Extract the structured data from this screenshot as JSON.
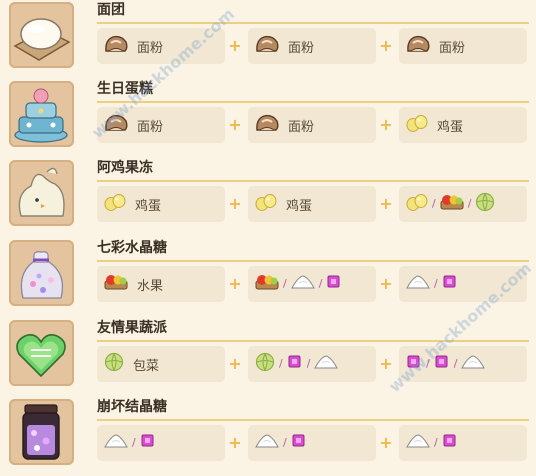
{
  "recipes": [
    {
      "title": "面团",
      "thumb": "dough-icon",
      "slots": [
        [
          {
            "icon": "flour-icon",
            "label": "面粉"
          }
        ],
        [
          {
            "icon": "flour-icon",
            "label": "面粉"
          }
        ],
        [
          {
            "icon": "flour-icon",
            "label": "面粉"
          }
        ]
      ]
    },
    {
      "title": "生日蛋糕",
      "thumb": "birthday-cake-icon",
      "slots": [
        [
          {
            "icon": "flour-icon",
            "label": "面粉"
          }
        ],
        [
          {
            "icon": "flour-icon",
            "label": "面粉"
          }
        ],
        [
          {
            "icon": "egg-icon",
            "label": "鸡蛋"
          }
        ]
      ]
    },
    {
      "title": "阿鸡果冻",
      "thumb": "chick-jelly-icon",
      "slots": [
        [
          {
            "icon": "egg-icon",
            "label": "鸡蛋"
          }
        ],
        [
          {
            "icon": "egg-icon",
            "label": "鸡蛋"
          }
        ],
        [
          {
            "icon": "egg-icon"
          },
          {
            "icon": "fruit-icon"
          },
          {
            "icon": "cabbage-icon"
          }
        ]
      ]
    },
    {
      "title": "七彩水晶糖",
      "thumb": "crystal-candy-bag-icon",
      "slots": [
        [
          {
            "icon": "fruit-icon",
            "label": "水果"
          }
        ],
        [
          {
            "icon": "fruit-icon"
          },
          {
            "icon": "salt-icon"
          },
          {
            "icon": "crystal-icon"
          }
        ],
        [
          {
            "icon": "salt-icon"
          },
          {
            "icon": "crystal-icon"
          }
        ]
      ]
    },
    {
      "title": "友情果蔬派",
      "thumb": "heart-pie-icon",
      "slots": [
        [
          {
            "icon": "cabbage-icon",
            "label": "包菜"
          }
        ],
        [
          {
            "icon": "cabbage-icon"
          },
          {
            "icon": "crystal-icon"
          },
          {
            "icon": "salt-icon"
          }
        ],
        [
          {
            "icon": "crystal-icon"
          },
          {
            "icon": "crystal-icon"
          },
          {
            "icon": "salt-icon"
          }
        ]
      ]
    },
    {
      "title": "崩坏结晶糖",
      "thumb": "crystal-jar-icon",
      "slots": [
        [
          {
            "icon": "salt-icon"
          },
          {
            "icon": "crystal-icon"
          }
        ],
        [
          {
            "icon": "salt-icon"
          },
          {
            "icon": "crystal-icon"
          }
        ],
        [
          {
            "icon": "salt-icon"
          },
          {
            "icon": "crystal-icon"
          }
        ]
      ]
    }
  ],
  "separator": "+",
  "multi_separator": "/",
  "watermark": "www.hackhome.com"
}
